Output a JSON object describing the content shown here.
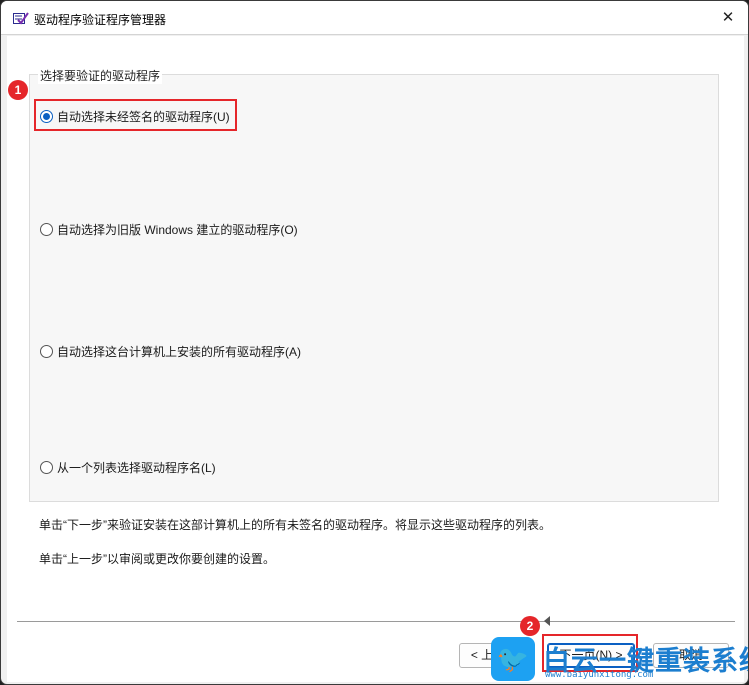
{
  "window": {
    "title": "驱动程序验证程序管理器",
    "close_glyph": "✕"
  },
  "group": {
    "legend": "选择要验证的驱动程序",
    "options": [
      {
        "label": "自动选择未经签名的驱动程序(U)",
        "checked": true
      },
      {
        "label": "自动选择为旧版 Windows 建立的驱动程序(O)",
        "checked": false
      },
      {
        "label": "自动选择这台计算机上安装的所有驱动程序(A)",
        "checked": false
      },
      {
        "label": "从一个列表选择驱动程序名(L)",
        "checked": false
      }
    ]
  },
  "descriptions": {
    "line1": "单击“下一步”来验证安装在这部计算机上的所有未签名的驱动程序。将显示这些驱动程序的列表。",
    "line2": "单击“上一步”以审阅或更改你要创建的设置。"
  },
  "buttons": {
    "back": "< 上一",
    "next": "下一页(N) >",
    "cancel": "取消"
  },
  "annotations": {
    "badge1": "1",
    "badge2": "2",
    "highlight_color": "#e5262a"
  },
  "watermark": {
    "brand": "白云一键重装系统",
    "url": "www.baiyunxitong.com",
    "icon": "twitter-bird-icon"
  },
  "colors": {
    "accent": "#0a5fc2",
    "window_bg": "#ffffff"
  }
}
